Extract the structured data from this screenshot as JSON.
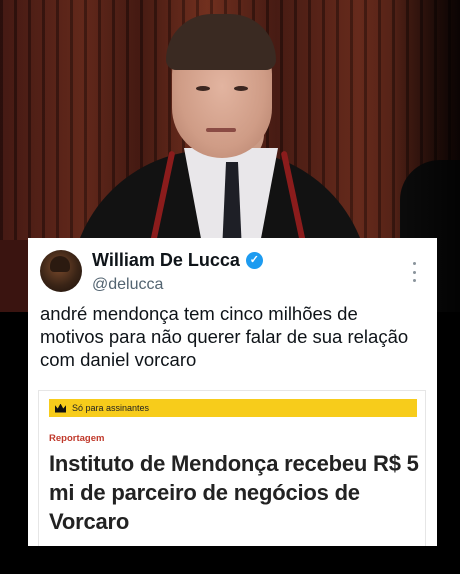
{
  "tweet": {
    "author_name": "William De Lucca",
    "handle": "@delucca",
    "verified": true,
    "text": "andré mendonça tem cinco milhões de motivos para não querer falar de sua relação com daniel vorcaro"
  },
  "article": {
    "paywall_label": "Só para assinantes",
    "section": "Reportagem",
    "headline": "Instituto de Mendonça recebeu R$ 5 mi de parceiro de negócios de Vorcaro"
  },
  "colors": {
    "verified_badge": "#1d9bf0",
    "paywall_bar": "#f7cc1b",
    "section_label": "#c0392b"
  },
  "icons": {
    "verified": "verified-check-icon",
    "more": "more-options-icon",
    "paywall": "crown-icon"
  }
}
